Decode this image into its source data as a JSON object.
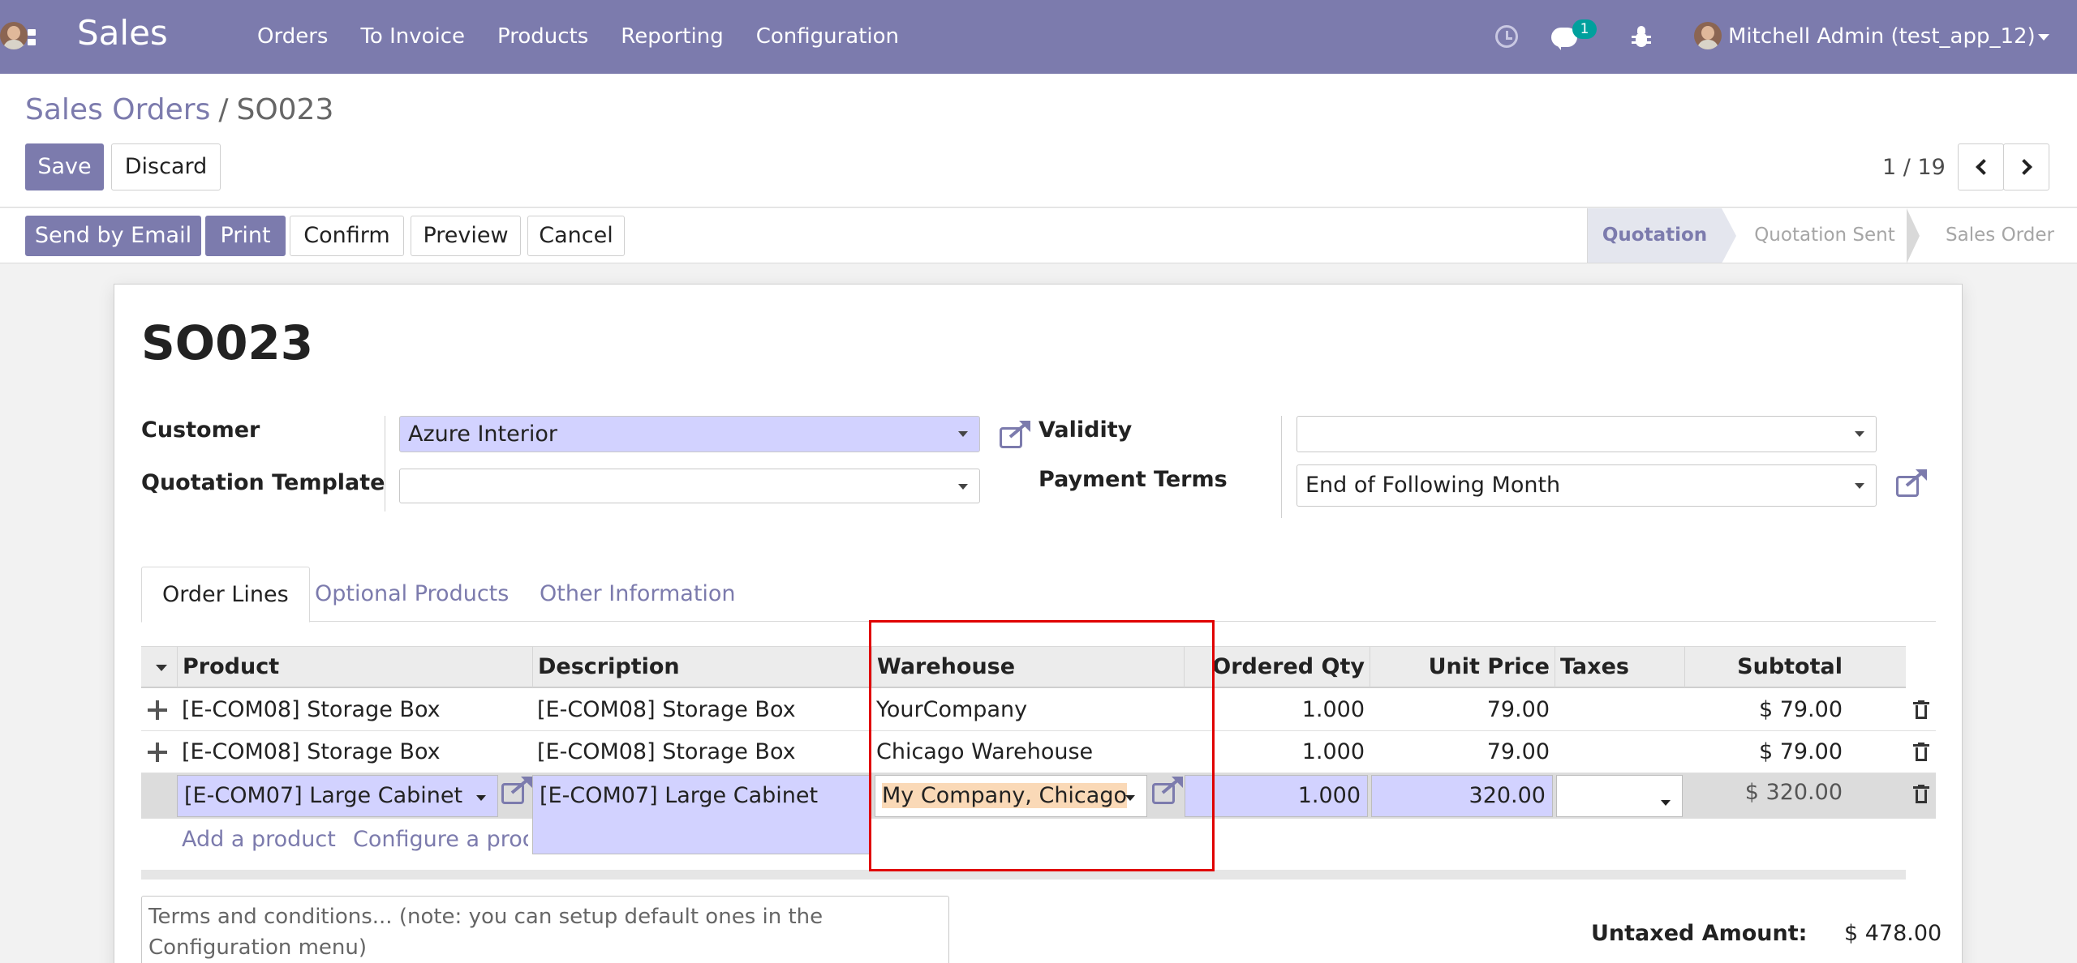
{
  "navbar": {
    "app_name": "Sales",
    "menu": [
      "Orders",
      "To Invoice",
      "Products",
      "Reporting",
      "Configuration"
    ],
    "chat_count": "1",
    "user": "Mitchell Admin (test_app_12)",
    "color": "#7c7bad"
  },
  "breadcrumb": {
    "parent": "Sales Orders",
    "separator": "/",
    "current": "SO023"
  },
  "actions": {
    "save": "Save",
    "discard": "Discard"
  },
  "pager": {
    "value": "1 / 19"
  },
  "statusbar": {
    "buttons": [
      "Send by Email",
      "Print",
      "Confirm",
      "Preview",
      "Cancel"
    ],
    "stages": [
      "Quotation",
      "Quotation Sent",
      "Sales Order"
    ],
    "active_stage": "Quotation"
  },
  "form": {
    "title": "SO023",
    "customer_label": "Customer",
    "customer_value": "Azure Interior",
    "template_label": "Quotation Template",
    "template_value": "",
    "validity_label": "Validity",
    "validity_value": "",
    "payment_terms_label": "Payment Terms",
    "payment_terms_value": "End of Following Month"
  },
  "tabs": [
    "Order Lines",
    "Optional Products",
    "Other Information"
  ],
  "table": {
    "columns": [
      "Product",
      "Description",
      "Warehouse",
      "Ordered Qty",
      "Unit Price",
      "Taxes",
      "Subtotal"
    ],
    "rows": [
      {
        "product": "[E-COM08] Storage Box",
        "description": "[E-COM08] Storage Box",
        "warehouse": "YourCompany",
        "qty": "1.000",
        "price": "79.00",
        "taxes": "",
        "subtotal": "$ 79.00"
      },
      {
        "product": "[E-COM08] Storage Box",
        "description": "[E-COM08] Storage Box",
        "warehouse": "Chicago Warehouse",
        "qty": "1.000",
        "price": "79.00",
        "taxes": "",
        "subtotal": "$ 79.00"
      }
    ],
    "edit_row": {
      "product": "[E-COM07] Large Cabinet",
      "description": "[E-COM07] Large Cabinet",
      "warehouse": "My Company, Chicago",
      "qty": "1.000",
      "price": "320.00",
      "taxes": "",
      "subtotal": "$ 320.00"
    },
    "add_product": "Add a product",
    "configure_product": "Configure a product"
  },
  "terms_placeholder": "Terms and conditions... (note: you can setup default ones in the Configuration menu)",
  "totals": {
    "untaxed_label": "Untaxed Amount:",
    "untaxed_value": "$ 478.00"
  }
}
